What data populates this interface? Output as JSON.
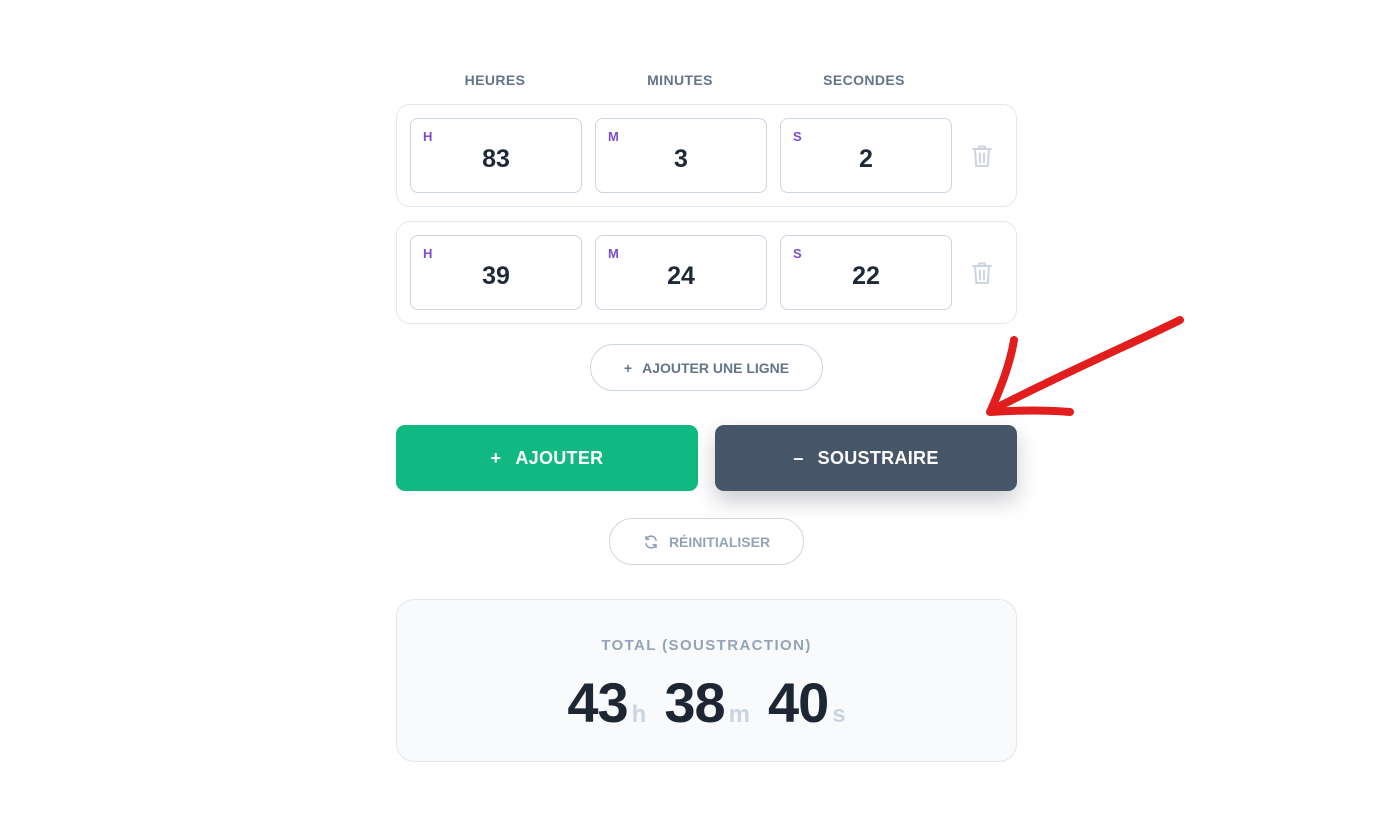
{
  "headers": {
    "hours": "HEURES",
    "minutes": "MINUTES",
    "seconds": "SECONDES"
  },
  "rows": [
    {
      "h_tag": "H",
      "h": "83",
      "m_tag": "M",
      "m": "3",
      "s_tag": "S",
      "s": "2"
    },
    {
      "h_tag": "H",
      "h": "39",
      "m_tag": "M",
      "m": "24",
      "s_tag": "S",
      "s": "22"
    }
  ],
  "add_line": {
    "icon": "+",
    "label": "AJOUTER UNE LIGNE"
  },
  "actions": {
    "add": {
      "icon": "+",
      "label": "AJOUTER",
      "color": "#10b981"
    },
    "subtract": {
      "icon": "–",
      "label": "SOUSTRAIRE",
      "color": "#475569"
    }
  },
  "reset": {
    "icon": "refresh-icon",
    "label": "RÉINITIALISER"
  },
  "total": {
    "label": "TOTAL (SOUSTRACTION)",
    "hours": "43",
    "hours_unit": "h",
    "minutes": "38",
    "minutes_unit": "m",
    "seconds": "40",
    "seconds_unit": "s"
  },
  "annotation": {
    "icon": "red-arrow-annotation",
    "color": "#e11d1d"
  }
}
